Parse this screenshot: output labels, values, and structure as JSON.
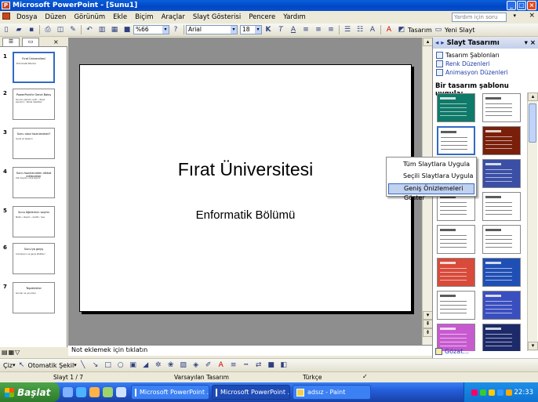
{
  "window": {
    "title": "Microsoft PowerPoint - [Sunu1]"
  },
  "menu": {
    "items": [
      "Dosya",
      "Düzen",
      "Görünüm",
      "Ekle",
      "Biçim",
      "Araçlar",
      "Slayt Gösterisi",
      "Pencere",
      "Yardım"
    ],
    "help_placeholder": "Yardım için soru yazın"
  },
  "toolbar": {
    "zoom": "%66",
    "font": "Arial",
    "font_size": "18",
    "bold": "K",
    "italic": "T",
    "underline": "A",
    "design_label": "Tasarım",
    "new_slide_label": "Yeni Slayt"
  },
  "slides": [
    {
      "num": "1",
      "title": "Fırat Üniversitesi",
      "body": "Enformatik Bölümü"
    },
    {
      "num": "2",
      "title": "PowerPoint'e Genel Bakış",
      "body": "Sunum yazılımı nedir • Slayt kavramı • Temel özellikler"
    },
    {
      "num": "3",
      "title": "Sunu nasıl hazırlanmalı?",
      "body": "İçerik ve tasarım"
    },
    {
      "num": "4",
      "title": "Sunu hazırlanırken dikkat edilecekler",
      "body": "Yazı boyutu, renk seçimi"
    },
    {
      "num": "5",
      "title": "Sunu öğelerinin seçimi",
      "body": "Metin • Resim • Grafik • Ses"
    },
    {
      "num": "6",
      "title": "Sunu'ya geçiş",
      "body": "Animasyon ve geçiş efektleri"
    },
    {
      "num": "7",
      "title": "Teşekkürler",
      "body": "Sorular ve yorumlar"
    }
  ],
  "main_slide": {
    "title": "Fırat Üniversitesi",
    "subtitle": "Enformatik Bölümü"
  },
  "notes": {
    "placeholder": "Not eklemek için tıklatın"
  },
  "taskpane": {
    "title": "Slayt Tasarımı",
    "links": [
      "Tasarım Şablonları",
      "Renk Düzenleri",
      "Animasyon Düzenleri"
    ],
    "apply_label": "Bir tasarım şablonu uygula:",
    "browse": "Gözat...",
    "templates": [
      {
        "bg": "#0f7a6a"
      },
      {
        "bg": "#ffffff"
      },
      {
        "bg": "#ffffff"
      },
      {
        "bg": "#7a1f0a"
      },
      {
        "bg": "#5a3fa0"
      },
      {
        "bg": "#3a4fa5"
      },
      {
        "bg": "#ffffff"
      },
      {
        "bg": "#ffffff"
      },
      {
        "bg": "#ffffff"
      },
      {
        "bg": "#ffffff"
      },
      {
        "bg": "#d84a3a"
      },
      {
        "bg": "#1f4fb5"
      },
      {
        "bg": "#ffffff"
      },
      {
        "bg": "#3a4fbf"
      },
      {
        "bg": "#c85ad0"
      },
      {
        "bg": "#1c2a6a"
      }
    ]
  },
  "context_menu": {
    "items": [
      "Tüm Slaytlara Uygula",
      "Seçili Slaytlara Uygula",
      "Geniş Önizlemeleri Göster"
    ],
    "highlighted": 2
  },
  "drawbar": {
    "draw": "Çiz",
    "autoshapes": "Otomatik Şekil"
  },
  "status": {
    "slide": "Slayt 1 / 7",
    "design": "Varsayılan Tasarım",
    "language": "Türkçe"
  },
  "taskbar": {
    "start": "Başlat",
    "tasks": [
      "Microsoft PowerPoint ...",
      "Microsoft PowerPoint ...",
      "adsız - Paint"
    ],
    "clock": "22:33"
  }
}
